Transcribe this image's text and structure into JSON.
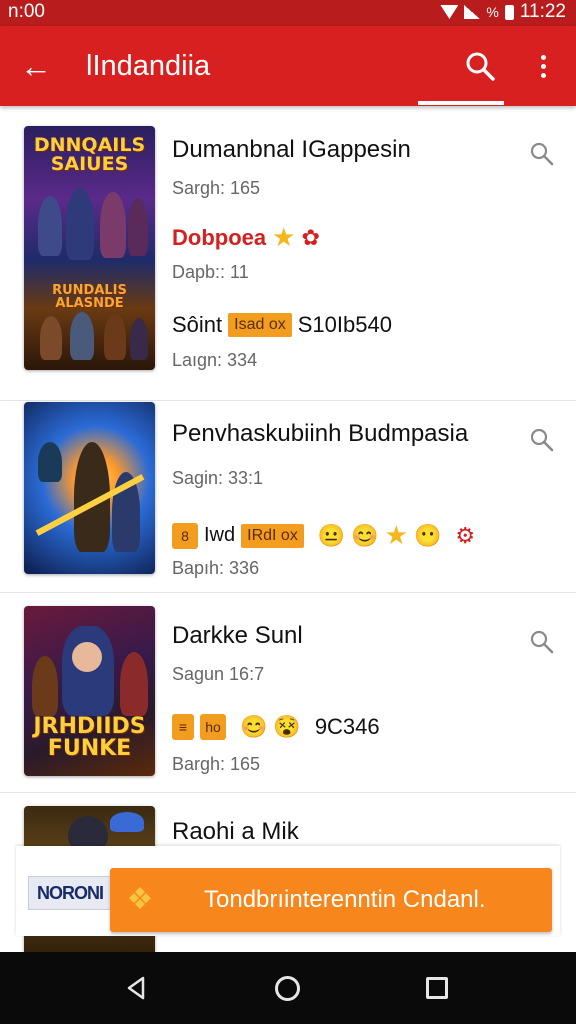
{
  "status_bar": {
    "time_left": "n:00",
    "battery": "%",
    "time_right": "11:22"
  },
  "app_bar": {
    "title": "lIndandiia",
    "back_icon": "arrow-left-icon",
    "search_icon": "search-icon",
    "more_icon": "more-vert-icon"
  },
  "items": [
    {
      "cover_text_top": "DNNQAILS SAIUES",
      "cover_text_bottom": "RUNDALIS ALASNDE",
      "name": "Dumanbnal IGappesin",
      "meta1": "Sargh: 165",
      "genre": "Dobpoea",
      "meta2": "Dapb:: 11",
      "row_label": "Sôint",
      "row_badge": "Isad ox",
      "row_value": "S10Ib540",
      "meta3": "Laıgn: 334"
    },
    {
      "name": "Penvhaskubiinh Budmpasia",
      "meta1": "Sagin: 33:1",
      "row_sq": "8",
      "row_label": "Iwd",
      "row_badge": "IRdI ox",
      "meta2": "Bapıh: 336"
    },
    {
      "cover_text": "JRHDIIDS FUNKE",
      "name": "Darkke Sunl",
      "meta1": "Sagun 16:7",
      "row_sq2": "ho",
      "row_value": "9C346",
      "meta2": "Bargh: 165"
    },
    {
      "name": "Raohi a Mik"
    }
  ],
  "ad": {
    "logo": "NORONI",
    "cta": "Tondbrıinterenntin Cndanl."
  },
  "nav": {
    "back_icon": "nav-back-icon",
    "home_icon": "nav-home-icon",
    "recents_icon": "nav-recents-icon"
  }
}
